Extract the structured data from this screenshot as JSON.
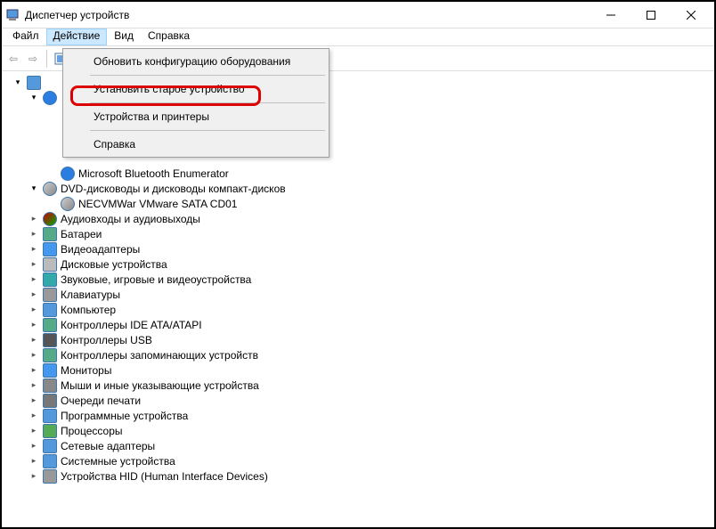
{
  "window": {
    "title": "Диспетчер устройств"
  },
  "menubar": {
    "file": "Файл",
    "action": "Действие",
    "view": "Вид",
    "help": "Справка"
  },
  "dropdown": {
    "refresh": "Обновить конфигурацию оборудования",
    "legacy": "Установить старое устройство",
    "devices": "Устройства и принтеры",
    "help": "Справка"
  },
  "tree": {
    "root_hidden": "",
    "bt_enum": "Microsoft Bluetooth Enumerator",
    "dvd": "DVD-дисководы и дисководы компакт-дисков",
    "dvd_item": "NECVMWar VMware SATA CD01",
    "audio": "Аудиовходы и аудиовыходы",
    "battery": "Батареи",
    "video": "Видеоадаптеры",
    "disks": "Дисковые устройства",
    "sound": "Звуковые, игровые и видеоустройства",
    "kbd": "Клавиатуры",
    "computer": "Компьютер",
    "ide": "Контроллеры IDE ATA/ATAPI",
    "usb": "Контроллеры USB",
    "storage": "Контроллеры запоминающих устройств",
    "monitor": "Мониторы",
    "mouse": "Мыши и иные указывающие устройства",
    "print": "Очереди печати",
    "prog": "Программные устройства",
    "cpu": "Процессоры",
    "net": "Сетевые адаптеры",
    "sys": "Системные устройства",
    "hid": "Устройства HID (Human Interface Devices)"
  }
}
